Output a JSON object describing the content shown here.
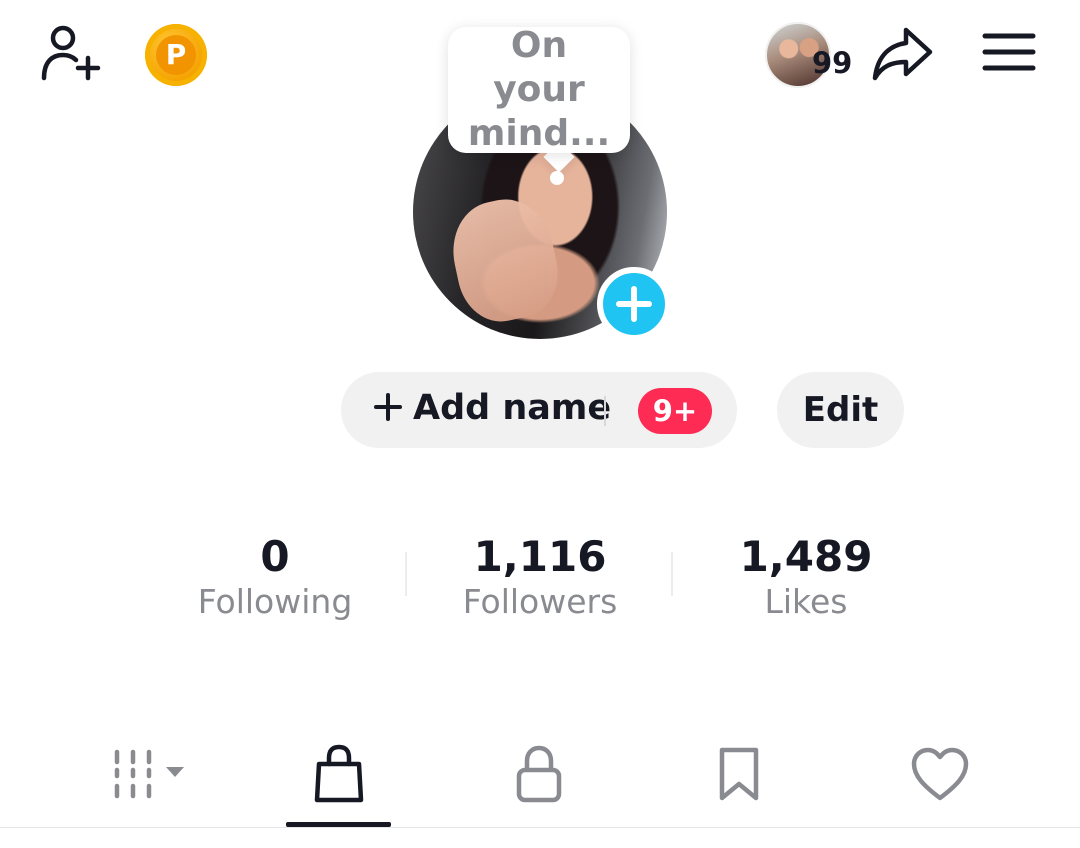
{
  "header": {
    "add_friend_icon": "add-friend-icon",
    "coin_label": "P",
    "coin_color": "#f4a000",
    "friends_count": "99",
    "share_icon": "share-icon",
    "menu_icon": "menu-icon"
  },
  "profile": {
    "bubble_text": "On your mind...",
    "add_name_label": "Add name",
    "notification_badge": "9+",
    "edit_label": "Edit",
    "accent_blue": "#20c4f2",
    "badge_red": "#fe2c55"
  },
  "stats": [
    {
      "value": "0",
      "label": "Following"
    },
    {
      "value": "1,116",
      "label": "Followers"
    },
    {
      "value": "1,489",
      "label": "Likes"
    }
  ],
  "tabs": [
    {
      "icon": "grid-icon",
      "active": false
    },
    {
      "icon": "shopping-bag-icon",
      "active": true
    },
    {
      "icon": "lock-icon",
      "active": false
    },
    {
      "icon": "bookmark-icon",
      "active": false
    },
    {
      "icon": "heart-icon",
      "active": false
    }
  ]
}
